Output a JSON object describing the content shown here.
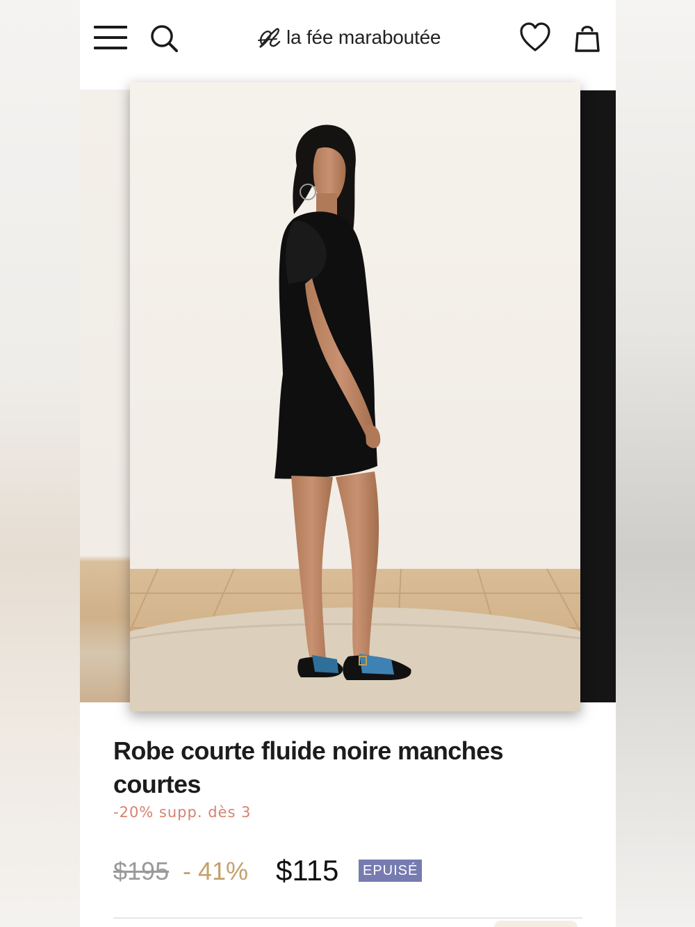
{
  "header": {
    "brand": "la fée maraboutée",
    "icons": [
      "menu-icon",
      "search-icon",
      "heart-icon",
      "bag-icon"
    ]
  },
  "product": {
    "title": "Robe courte fluide noire manches courtes",
    "promo": "-20% supp. dès 3",
    "price_old": "$195",
    "discount": "- 41%",
    "price_new": "$115",
    "status_badge": "EPUISÉ"
  },
  "colors": {
    "promo": "#d5826f",
    "discount": "#c4a06b",
    "badge": "#767bb0",
    "old_price": "#9a9a9a"
  }
}
